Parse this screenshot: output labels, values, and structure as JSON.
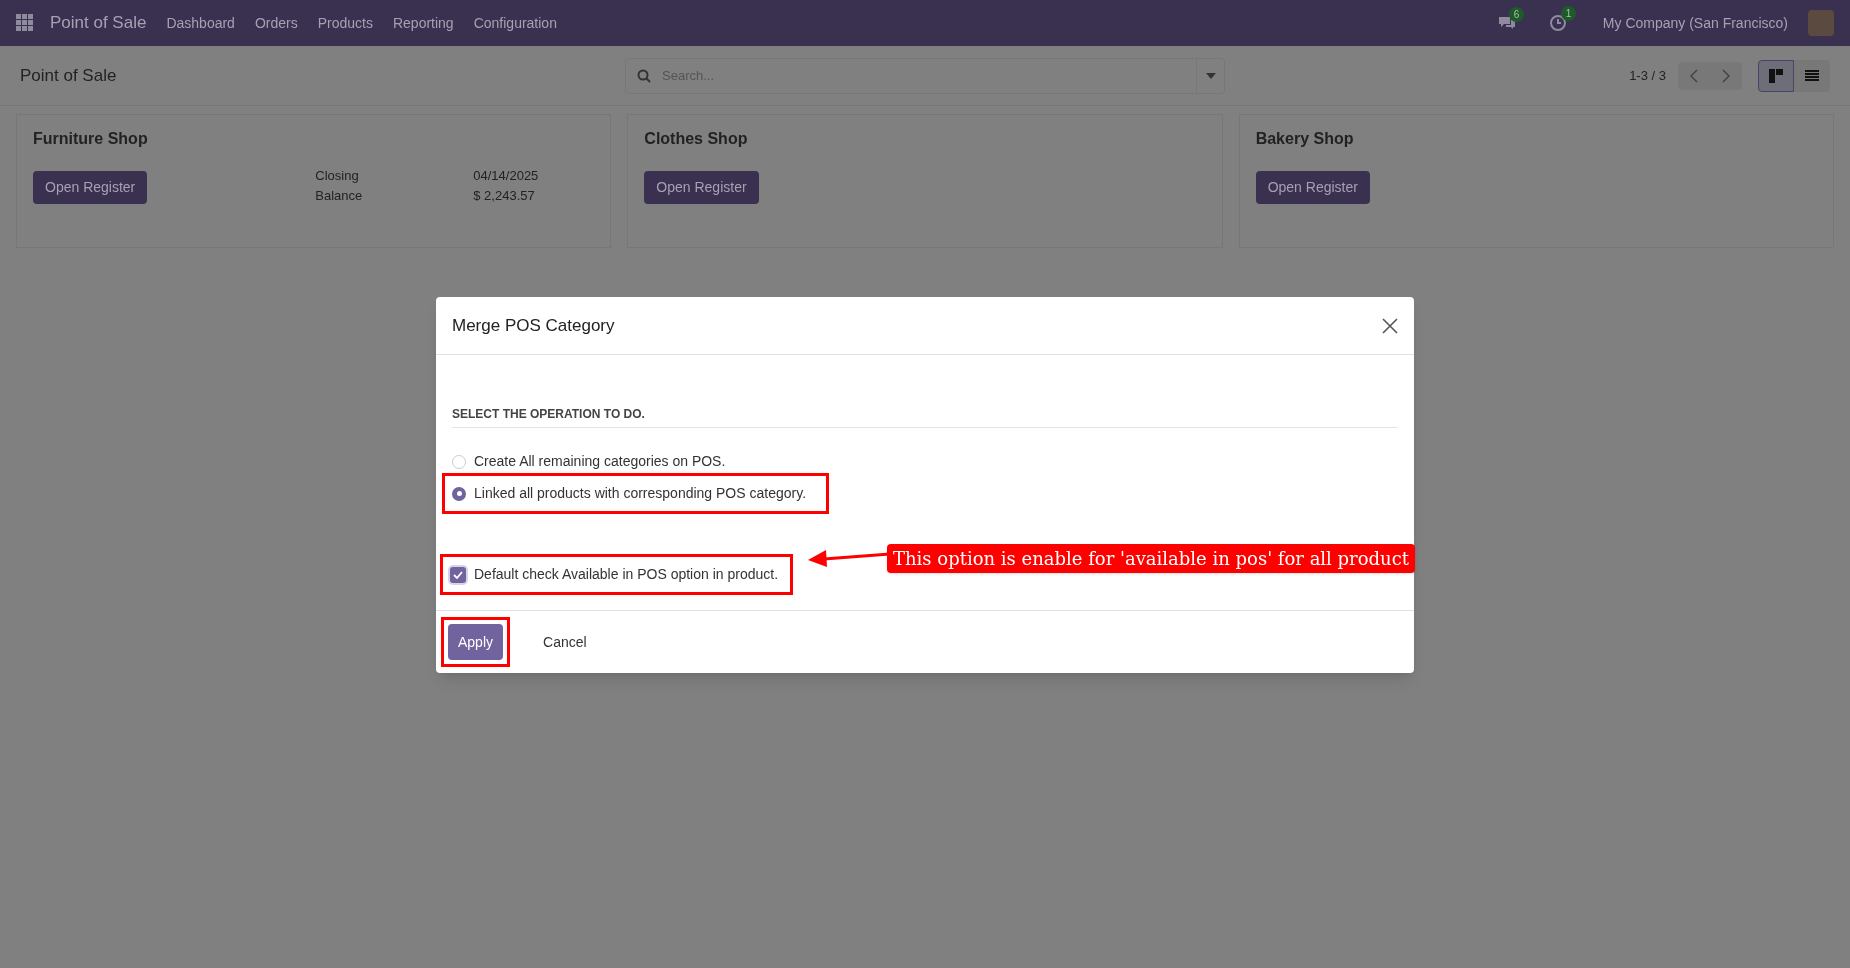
{
  "navbar": {
    "app_title": "Point of Sale",
    "menu": [
      "Dashboard",
      "Orders",
      "Products",
      "Reporting",
      "Configuration"
    ],
    "messages_count": "6",
    "activities_count": "1",
    "company": "My Company (San Francisco)"
  },
  "control_panel": {
    "breadcrumb": "Point of Sale",
    "search": {
      "placeholder": "Search..."
    },
    "pager": "1-3 / 3",
    "views": [
      {
        "kind": "kanban",
        "selected": true
      },
      {
        "kind": "list",
        "selected": false
      }
    ]
  },
  "shops": [
    {
      "name": "Furniture Shop",
      "button": "Open Register",
      "details": [
        {
          "label": "Closing",
          "value": "04/14/2025"
        },
        {
          "label": "Balance",
          "value": "$ 2,243.57"
        }
      ]
    },
    {
      "name": "Clothes Shop",
      "button": "Open Register"
    },
    {
      "name": "Bakery Shop",
      "button": "Open Register"
    }
  ],
  "dialog": {
    "title": "Merge POS Category",
    "section": "SELECT THE OPERATION TO DO.",
    "options": [
      {
        "label": "Create All remaining categories on POS.",
        "selected": false,
        "highlighted": false
      },
      {
        "label": "Linked all products with corresponding POS category.",
        "selected": true,
        "highlighted": true
      }
    ],
    "checkbox": {
      "label": "Default check Available in POS option in product.",
      "checked": true,
      "highlighted": true
    },
    "buttons": [
      {
        "label": "Apply",
        "kind": "primary",
        "highlighted": true
      },
      {
        "label": "Cancel",
        "kind": "secondary",
        "highlighted": false
      }
    ]
  },
  "callout": "This option is enable for 'available in pos' for all product"
}
